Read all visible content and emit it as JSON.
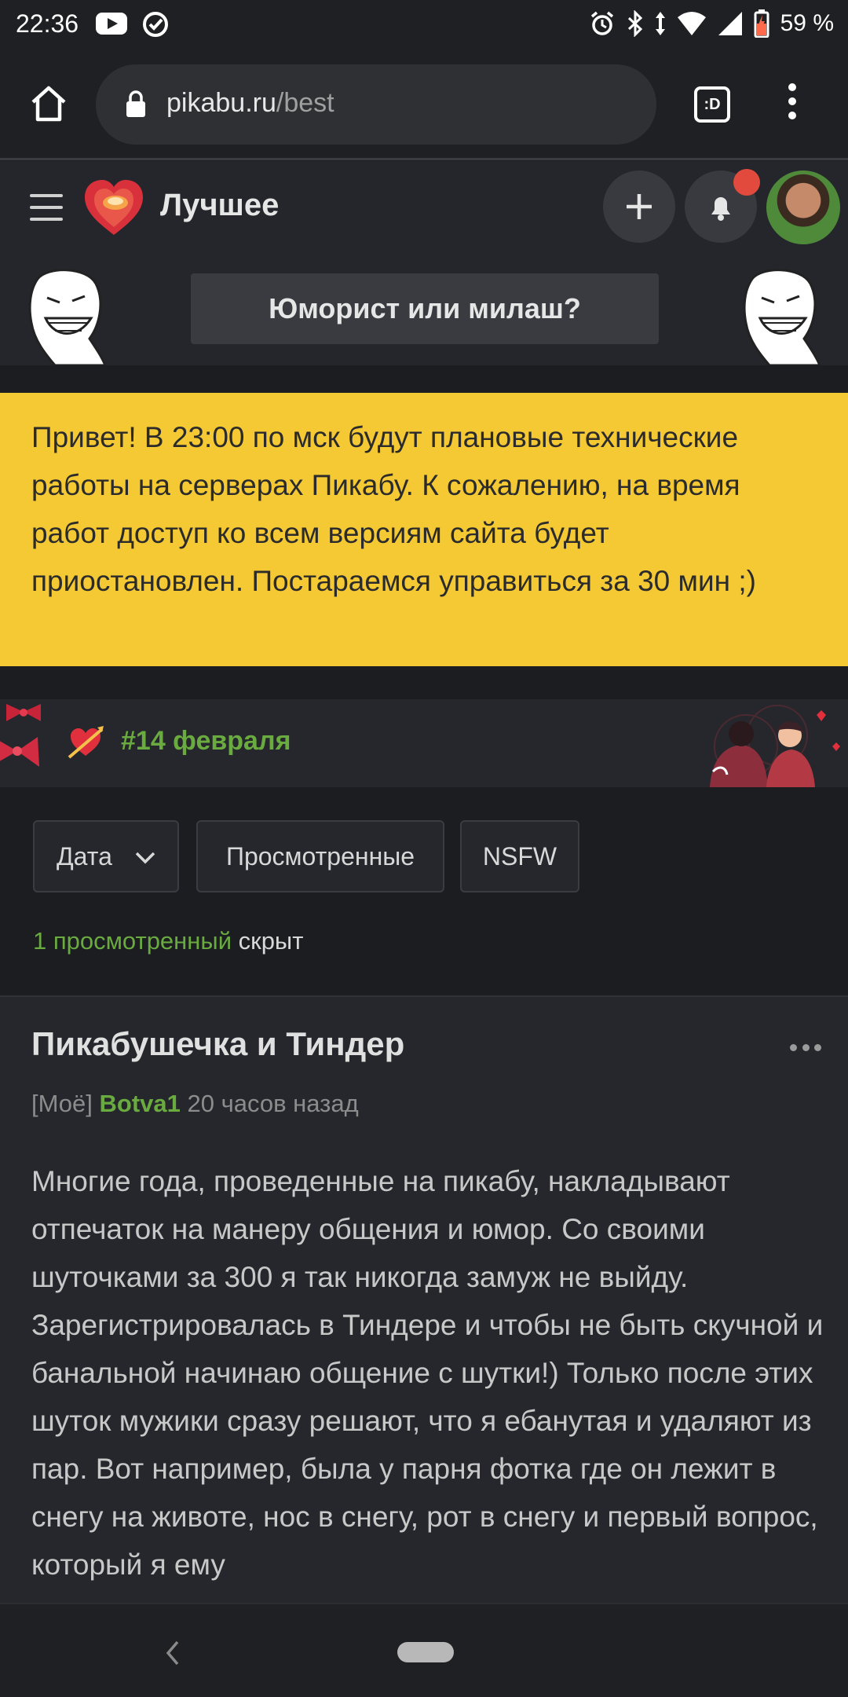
{
  "status_bar": {
    "time": "22:36",
    "battery": "59 %",
    "icons": [
      "youtube-icon",
      "check-circle-icon",
      "alarm-icon",
      "bluetooth-icon",
      "data-arrows-icon",
      "wifi-icon",
      "signal-icon",
      "battery-icon"
    ]
  },
  "browser": {
    "url_host": "pikabu.ru",
    "url_path": "/best",
    "tabs_label": ":D"
  },
  "header": {
    "title": "Лучшее"
  },
  "banner": {
    "button_label": "Юморист или милаш?"
  },
  "notice": {
    "text": "Привет! В 23:00 по мск будут плановые технические работы на серверах Пикабу. К сожалению, на время работ доступ ко всем версиям сайта будет приостановлен. Постараемся управиться за 30 мин ;)",
    "background": "#f4c934"
  },
  "holiday": {
    "tag": "#14 февраля"
  },
  "filters": {
    "date_label": "Дата",
    "viewed_label": "Просмотренные",
    "nsfw_label": "NSFW",
    "hidden_link": "1 просмотренный",
    "hidden_suffix": " скрыт"
  },
  "post": {
    "title": "Пикабушечка и Тиндер",
    "tag": "[Моё]",
    "author": "Botva1",
    "time": "20 часов назад",
    "body": "Многие года, проведенные на пикабу, накладывают отпечаток на манеру общения и юмор. Со своими шуточками за 300 я так никогда замуж не выйду. Зарегистрировалась в Тиндере и чтобы не быть скучной и банальной начинаю общение с шутки!) Только после этих шуток мужики сразу решают, что я ебанутая и удаляют из пар. Вот например, была у парня фотка где он лежит в снегу на животе, нос в снегу, рот в снегу и первый вопрос, который я ему"
  },
  "colors": {
    "accent_green": "#6aab3f",
    "notification_red": "#e14a3c"
  }
}
